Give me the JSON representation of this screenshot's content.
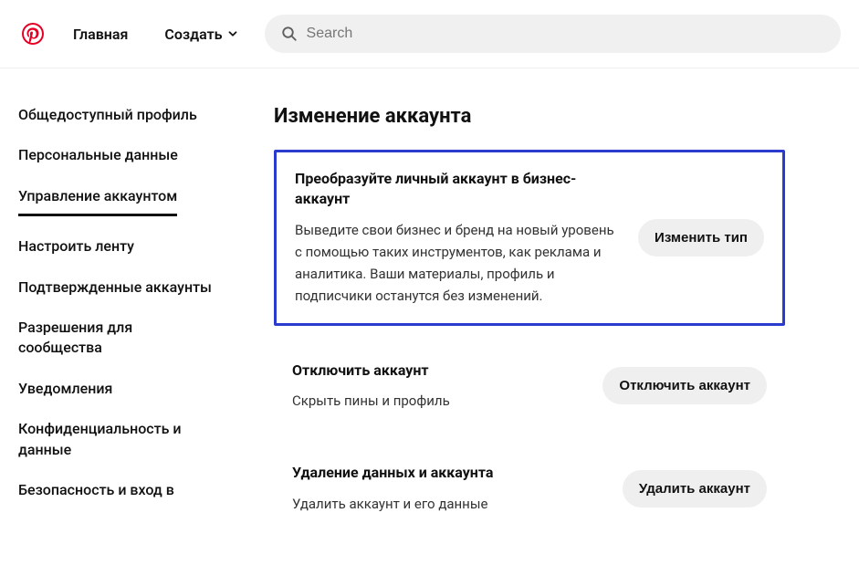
{
  "header": {
    "home": "Главная",
    "create": "Создать",
    "search_placeholder": "Search"
  },
  "sidebar": {
    "items": [
      "Общедоступный профиль",
      "Персональные данные",
      "Управление аккаунтом",
      "Настроить ленту",
      "Подтвержденные аккаунты",
      "Разрешения для сообщества",
      "Уведомления",
      "Конфиденциальность и данные",
      "Безопасность и вход в"
    ]
  },
  "content": {
    "title": "Изменение аккаунта",
    "convert": {
      "title": "Преобразуйте личный аккаунт в бизнес-аккаунт",
      "desc": "Выведите свои бизнес и бренд на новый уровень с помощью таких инструментов, как реклама и аналитика. Ваши материалы, профиль и подписчики останутся без изменений.",
      "button": "Изменить тип"
    },
    "deactivate": {
      "title": "Отключить аккаунт",
      "desc": "Скрыть пины и профиль",
      "button": "Отключить аккаунт"
    },
    "delete": {
      "title": "Удаление данных и аккаунта",
      "desc": "Удалить аккаунт и его данные",
      "button": "Удалить аккаунт"
    }
  }
}
